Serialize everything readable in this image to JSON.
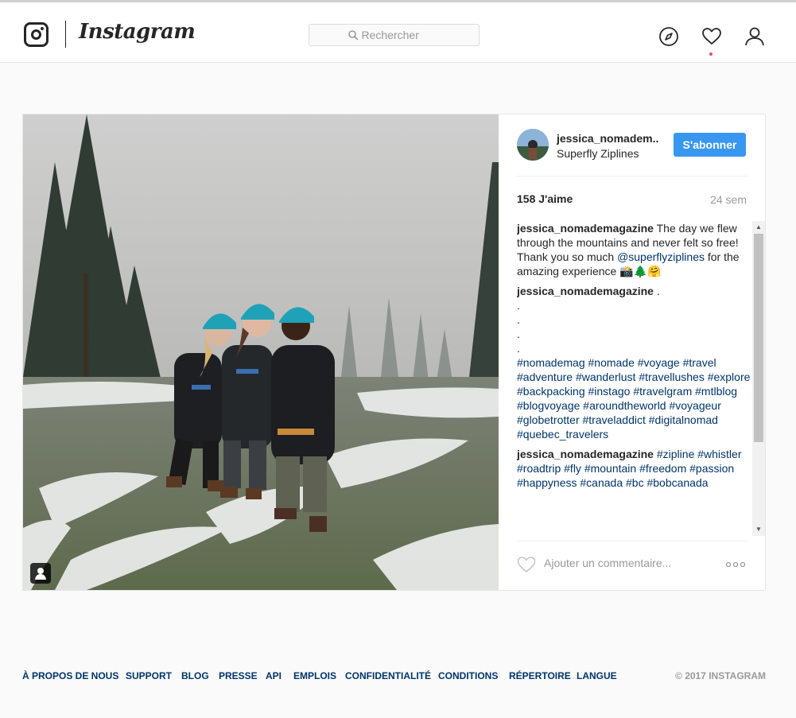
{
  "header": {
    "brand": "Instagram",
    "search_placeholder": "Rechercher",
    "icons": [
      "instagram-logo-icon",
      "search-icon",
      "compass-icon",
      "heart-icon",
      "profile-icon"
    ]
  },
  "post": {
    "username": "jessica_nomadem..",
    "location": "Superfly Ziplines",
    "follow_label": "S'abonner",
    "likes": "158 J'aime",
    "time": "24 sem",
    "comment_placeholder": "Ajouter un commentaire...",
    "comments": [
      {
        "author": "jessica_nomademagazine",
        "text_1": " The day we flew through the mountains and never felt so free! Thank you so much ",
        "mention": "@superflyziplines",
        "text_2": " for the amazing experience 📸🌲🤗"
      },
      {
        "author": "jessica_nomademagazine",
        "dots": [
          ".",
          ".",
          ".",
          ".",
          "."
        ],
        "hashtags": "#nomademag #nomade #voyage #travel #adventure #wanderlust #travellushes #explore #backpacking #instago #travelgram #mtlblog #blogvoyage #aroundtheworld #voyageur #globetrotter #traveladdict #digitalnomad #quebec_travelers"
      },
      {
        "author": "jessica_nomademagazine",
        "hashtags": "#zipline #whistler #roadtrip #fly #mountain #freedom #passion #happyness #canada #bc #bobcanada"
      }
    ]
  },
  "footer": {
    "links": [
      "À PROPOS DE NOUS",
      "SUPPORT",
      "BLOG",
      "PRESSE",
      "API",
      "EMPLOIS",
      "CONFIDENTIALITÉ",
      "CONDITIONS",
      "RÉPERTOIRE",
      "LANGUE"
    ],
    "copyright": "© 2017 INSTAGRAM"
  },
  "colors": {
    "accent": "#3897f0",
    "link": "#003569",
    "notification": "#ed4956"
  }
}
